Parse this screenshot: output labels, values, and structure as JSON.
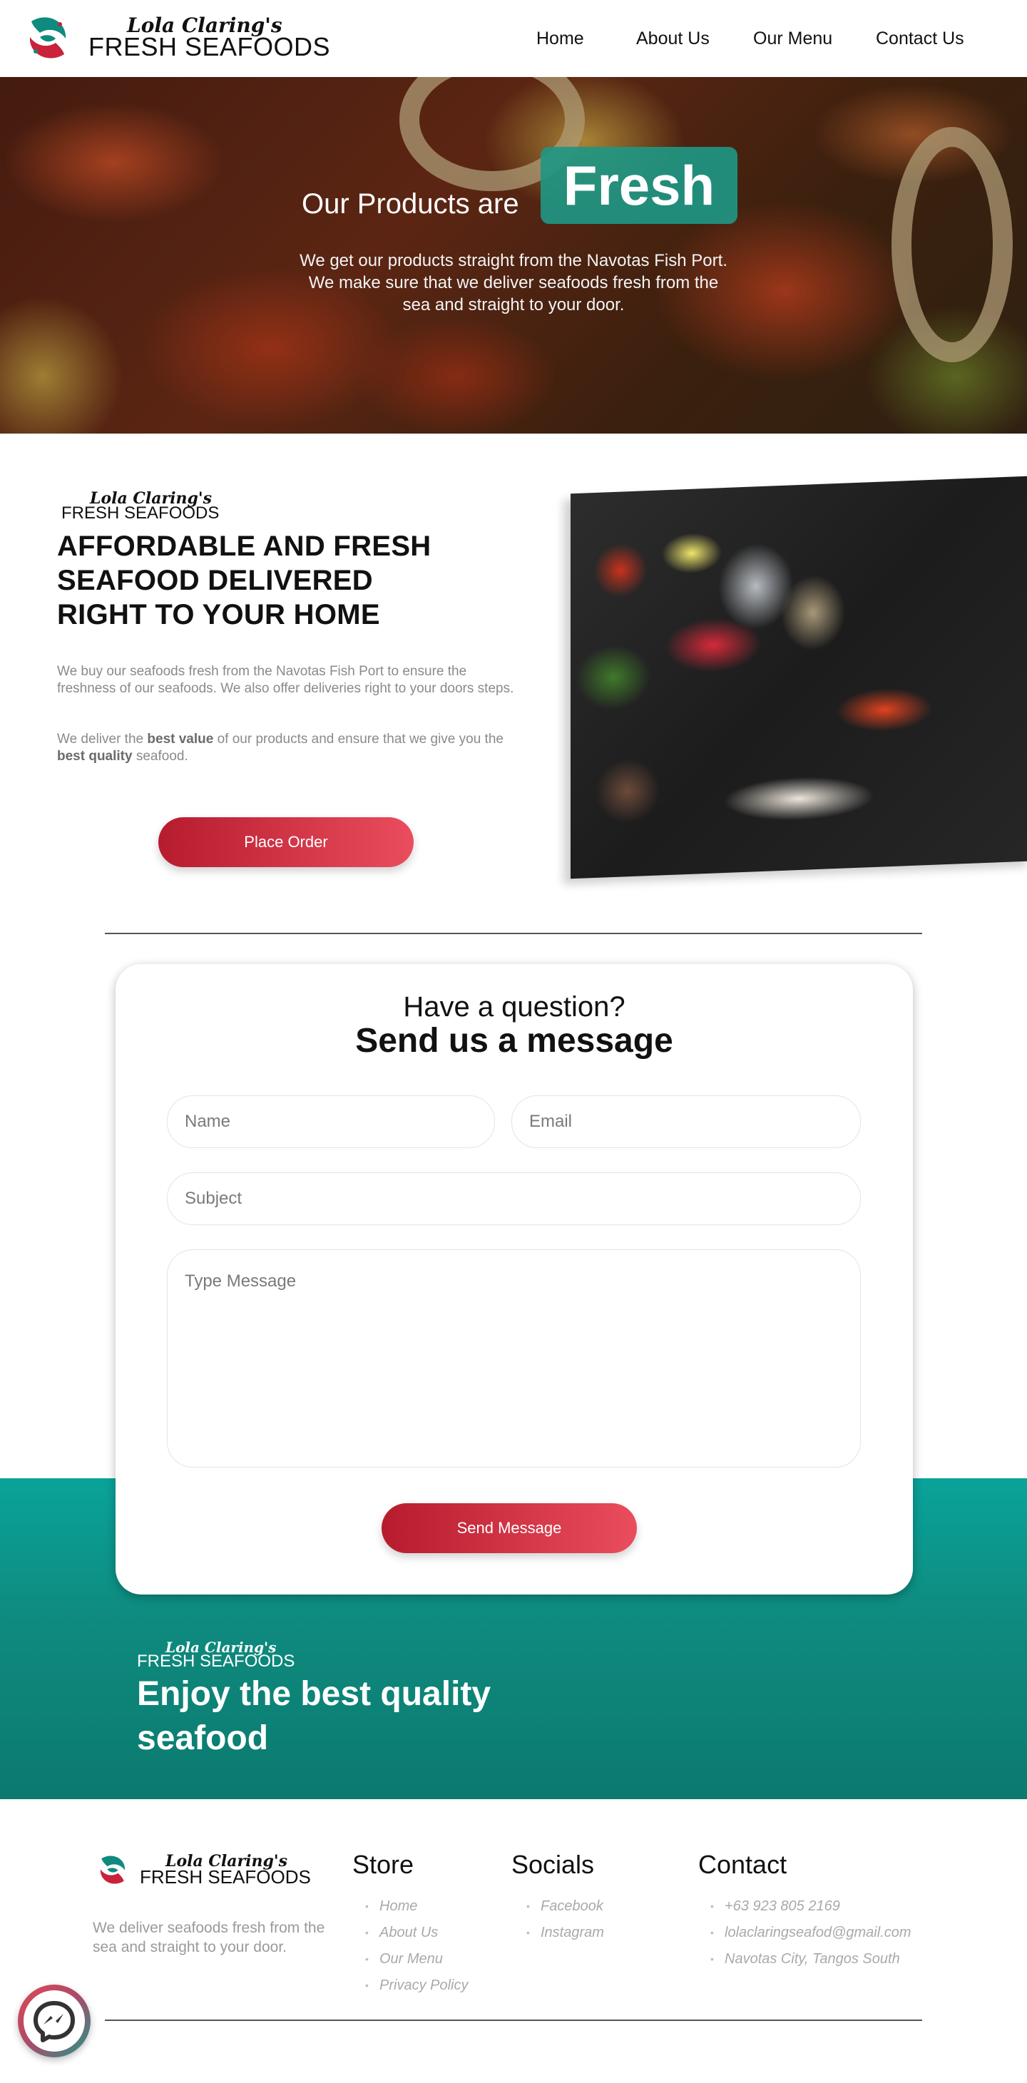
{
  "brand": {
    "script": "Lola Claring's",
    "name": "FRESH SEAFOODS",
    "colors": {
      "teal": "#0f8a7e",
      "red": "#c8233a",
      "red_light": "#ea4d5d"
    }
  },
  "nav": {
    "links": [
      "Home",
      "About Us",
      "Our Menu",
      "Contact Us"
    ]
  },
  "hero": {
    "title": "Our Products are",
    "highlight": "Fresh",
    "subtitle": "We get our products straight from the Navotas Fish Port. We make sure that we deliver seafoods fresh from the sea and straight to your door."
  },
  "about": {
    "heading": "AFFORDABLE AND FRESH SEAFOOD DELIVERED RIGHT TO YOUR HOME",
    "p1": "We buy our seafoods fresh from the Navotas Fish Port to ensure the freshness of our seafoods. We also offer deliveries right to your doors steps.",
    "p2_pre": "We deliver the ",
    "p2_b1": "best value",
    "p2_mid": " of our products and ensure that we give you the ",
    "p2_b2": "best quality",
    "p2_post": " seafood.",
    "button": "Place Order"
  },
  "contact_form": {
    "question": "Have a question?",
    "heading": "Send us a message",
    "name_placeholder": "Name",
    "email_placeholder": "Email",
    "subject_placeholder": "Subject",
    "message_placeholder": "Type Message",
    "button": "Send Message"
  },
  "banner": {
    "heading": "Enjoy the best quality seafood"
  },
  "footer": {
    "description": "We deliver seafoods fresh from the sea and straight to your door.",
    "store": {
      "title": "Store",
      "items": [
        "Home",
        "About Us",
        "Our Menu",
        "Privacy Policy"
      ]
    },
    "socials": {
      "title": "Socials",
      "items": [
        "Facebook",
        "Instagram"
      ]
    },
    "contact": {
      "title": "Contact",
      "items": [
        "+63 923 805 2169",
        "lolaclaringseafod@gmail.com",
        "Navotas City, Tangos South"
      ]
    }
  },
  "icons": {
    "logo": "fish-logo-icon",
    "chat": "messenger-icon"
  }
}
